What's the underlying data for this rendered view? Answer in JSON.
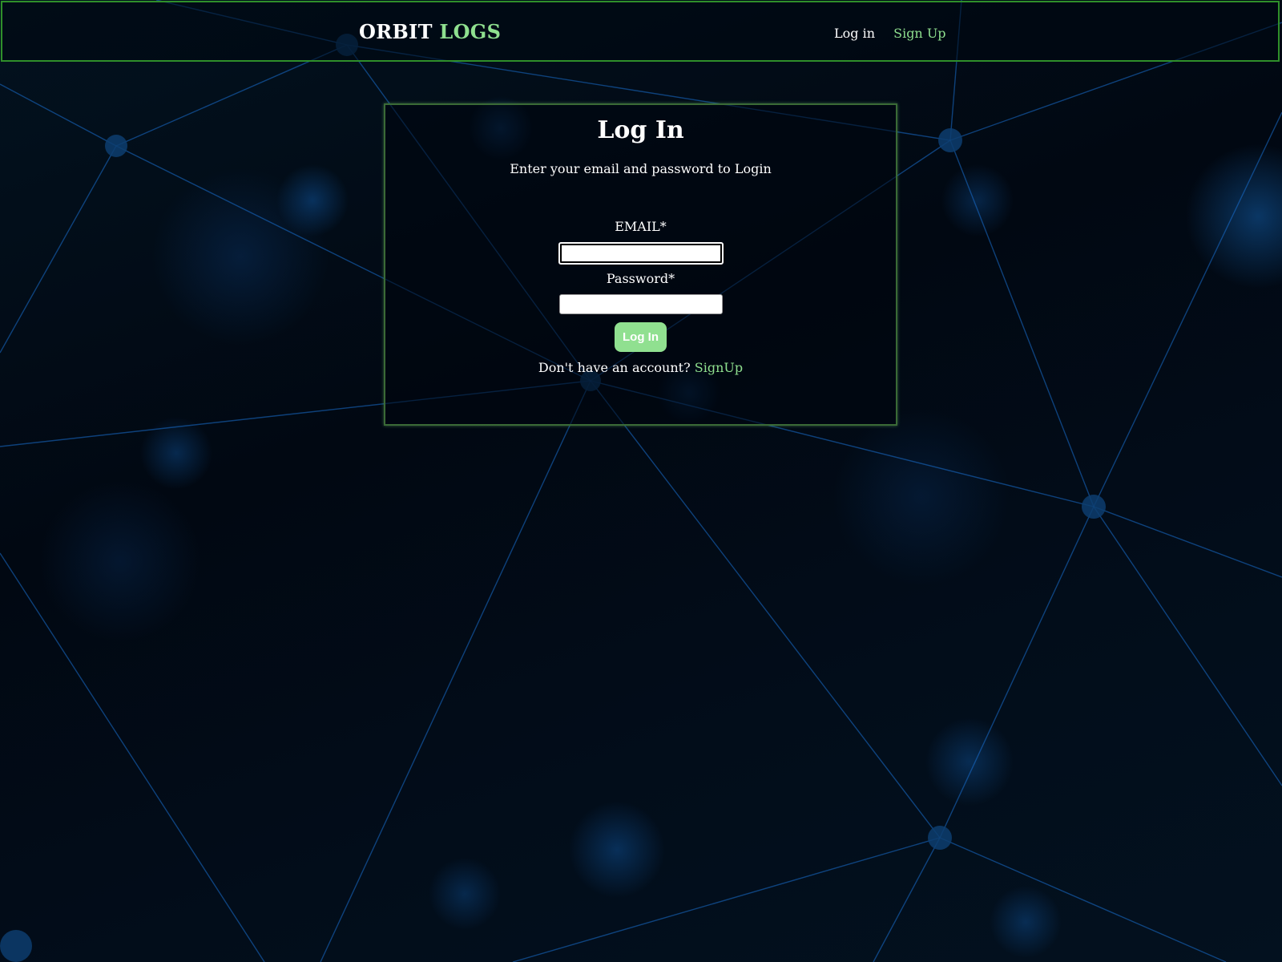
{
  "header": {
    "brand_part1": "ORBIT",
    "brand_part2": "LOGS",
    "nav": {
      "login_label": "Log in",
      "signup_label": "Sign Up"
    }
  },
  "login_form": {
    "title": "Log In",
    "subtitle": "Enter your email and password to Login",
    "email_label": "EMAIL*",
    "email_value": "",
    "password_label": "Password*",
    "password_value": "",
    "submit_label": "Log In",
    "no_account_text": "Don't have an account?",
    "signup_link_label": "SignUp"
  },
  "colors": {
    "accent_green": "#8fe08f",
    "border_green": "#2f8f2a",
    "background": "#01060d"
  }
}
